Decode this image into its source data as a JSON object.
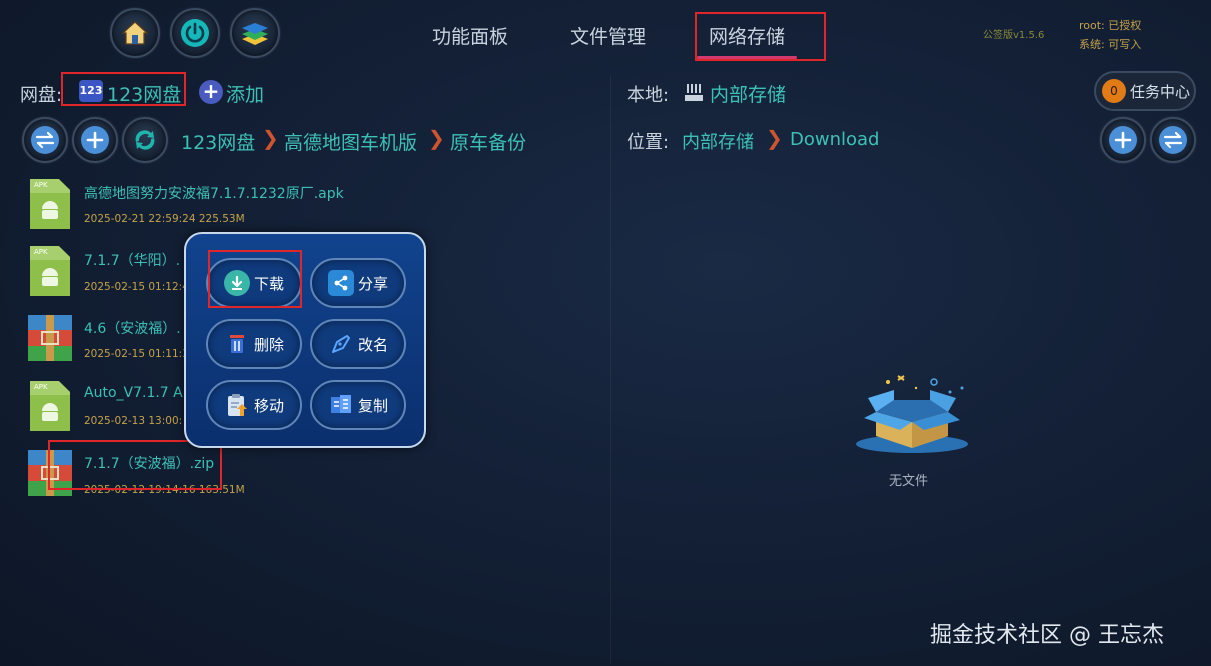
{
  "top": {
    "tabs": [
      "功能面板",
      "文件管理",
      "网络存储"
    ],
    "version": "公签版v1.5.6",
    "status_root": "root: 已授权",
    "status_system": "系统: 可写入"
  },
  "left": {
    "cloud_label": "网盘:",
    "cloud_badge": "123",
    "cloud_name": "123网盘",
    "add_label": "添加",
    "breadcrumb": [
      "123网盘",
      "高德地图车机版",
      "原车备份"
    ]
  },
  "right": {
    "local_label": "本地:",
    "local_name": "内部存储",
    "task_count": "0",
    "task_label": "任务中心",
    "location_label": "位置:",
    "breadcrumb": [
      "内部存储",
      "Download"
    ],
    "empty_text": "无文件"
  },
  "files": [
    {
      "type": "apk",
      "name": "高德地图努力安波福7.1.7.1232原厂.apk",
      "meta": "2025-02-21 22:59:24  225.53M"
    },
    {
      "type": "apk",
      "name": "7.1.7（华阳）.",
      "meta": "2025-02-15 01:12:4"
    },
    {
      "type": "zip",
      "name": "4.6（安波福）.",
      "meta": "2025-02-15 01:11:3"
    },
    {
      "type": "apk",
      "name": "Auto_V7.1.7  A",
      "meta": "2025-02-13 13:00:"
    },
    {
      "type": "zip",
      "name": "7.1.7（安波福）.zip",
      "meta": "2025-02-12 19:14:16  163.51M"
    }
  ],
  "popup": {
    "download": "下载",
    "share": "分享",
    "delete": "删除",
    "rename": "改名",
    "move": "移动",
    "copy": "复制"
  },
  "watermark": "掘金技术社区 @ 王忘杰",
  "colors": {
    "accent": "#3dc0b6",
    "highlight": "#e0262a",
    "meta": "#c6a34a",
    "popup": "#0b2f6d"
  }
}
